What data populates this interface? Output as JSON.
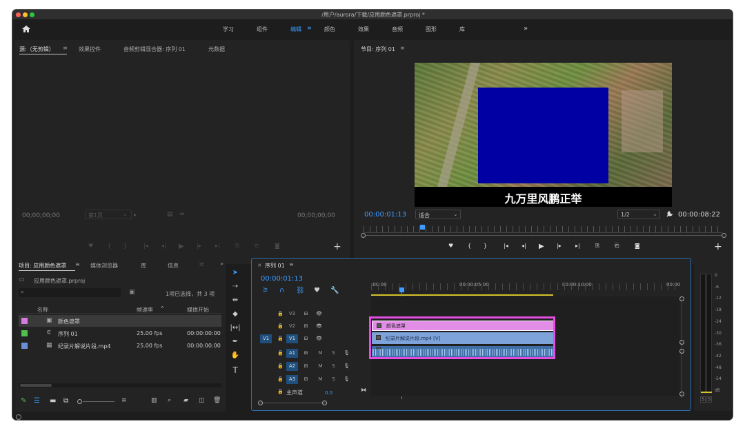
{
  "window": {
    "title": "/用户/aurora/下载/应用颜色遮罩.prproj *"
  },
  "workspace": {
    "tabs": [
      "学习",
      "组件",
      "编辑",
      "颜色",
      "效果",
      "音频",
      "图形",
      "库"
    ],
    "active_tab": "编辑",
    "overflow": "»"
  },
  "source_panel": {
    "tabs": [
      "源:（无剪辑）",
      "效果控件",
      "音频剪辑混合器: 序列 01",
      "元数据"
    ],
    "timecode_left": "00;00;00;00",
    "timecode_right": "00;00;00;00",
    "page_select": "第1页"
  },
  "program_panel": {
    "title": "节目: 序列 01",
    "timecode_current": "00:00:01:13",
    "timecode_duration": "00:00:08:22",
    "zoom": "适合",
    "resolution": "1/2",
    "subtitle": "九万里风鹏正举"
  },
  "project_panel": {
    "tabs": [
      "项目: 应用颜色遮罩",
      "媒体浏览器",
      "库",
      "信息"
    ],
    "file": "应用颜色遮罩.prproj",
    "selection_info": "1项已选择，共 3 项",
    "columns": [
      "名称",
      "帧速率",
      "媒体开始"
    ],
    "items": [
      {
        "name": "颜色遮罩",
        "fps": "",
        "start": "",
        "color": "#d77ae0"
      },
      {
        "name": "序列 01",
        "fps": "25.00 fps",
        "start": "00:00:00:00",
        "color": "#4fbf4f"
      },
      {
        "name": "纪录片解说片段.mp4",
        "fps": "25.00 fps",
        "start": "00:00:00:00",
        "color": "#6b8fd6"
      }
    ]
  },
  "timeline": {
    "tab": "序列 01",
    "timecode": "00:00:01:13",
    "ruler": [
      ":00:00",
      "00:00:05:00",
      "00:00:10:00",
      "00:00"
    ],
    "tracks_video": [
      "V3",
      "V2",
      "V1"
    ],
    "tracks_audio": [
      "A1",
      "A2",
      "A3"
    ],
    "source_patch": "V1",
    "master_label": "主声道",
    "master_value": "0.0",
    "clips": {
      "v2": "颜色遮罩",
      "v1": "纪录片解说片段.mp4 [V]"
    }
  },
  "meter": {
    "scale": [
      "0",
      "-6",
      "-12",
      "-18",
      "-24",
      "-30",
      "-36",
      "-42",
      "-48",
      "-54",
      "dB"
    ],
    "solo": [
      "S",
      "S"
    ]
  },
  "colors": {
    "accent": "#2e8ae6",
    "timecode": "#3d9bff",
    "color_matte": "#0000a3",
    "highlight_box": "#e24ee2"
  }
}
